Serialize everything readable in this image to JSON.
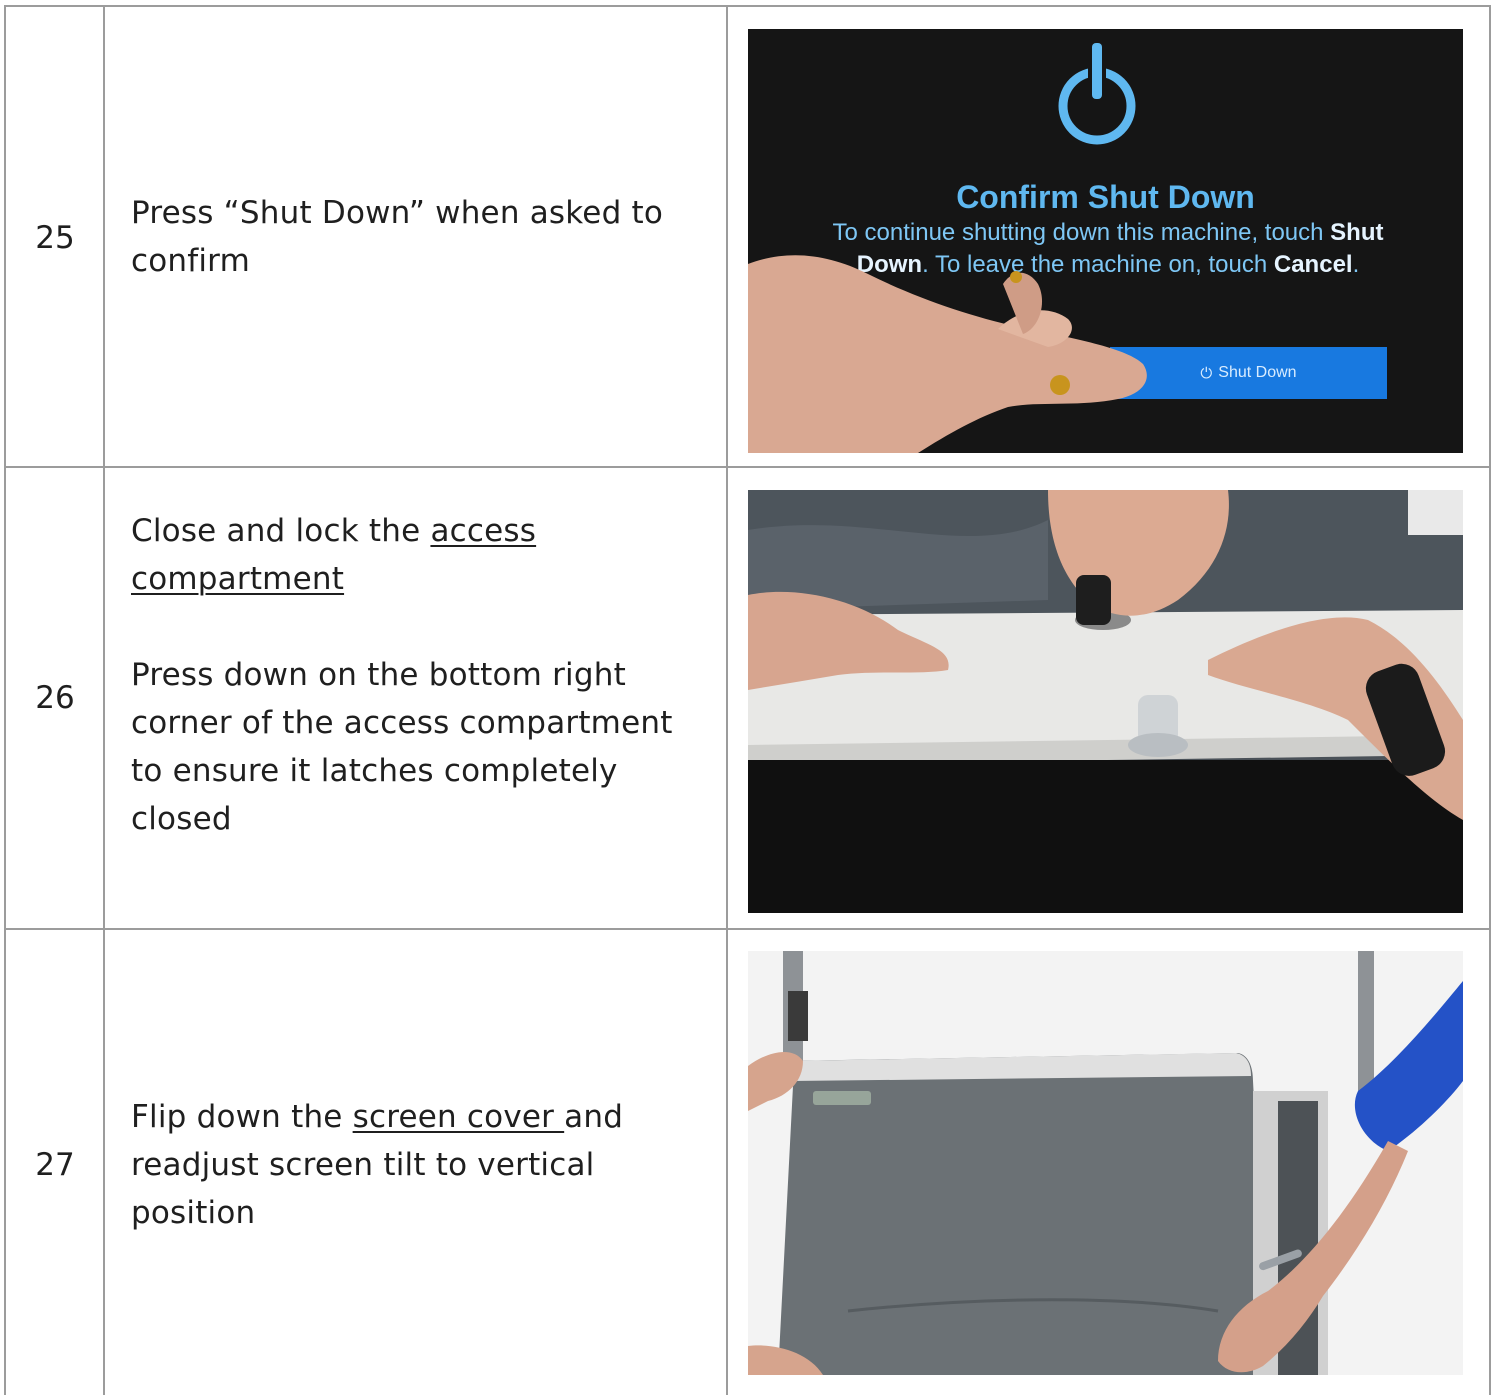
{
  "rows": [
    {
      "number": "25",
      "text": "Press “Shut Down” when asked to confirm",
      "photo": {
        "icon": "power-icon",
        "title": "Confirm Shut Down",
        "msg_part1": "To continue shutting down this machine, touch ",
        "msg_bold1": "Shut Down",
        "msg_part2": ". To leave the machine on, touch ",
        "msg_bold2": "Cancel",
        "msg_part3": ".",
        "button_label": "Shut Down"
      }
    },
    {
      "number": "26",
      "text_pre": "Close and lock the ",
      "text_link": "access compartment",
      "text2": "Press down on the bottom right corner of the access compartment to ensure it latches completely closed"
    },
    {
      "number": "27",
      "text_pre": "Flip down the ",
      "text_link": "screen cover ",
      "text_post": "and readjust screen tilt to vertical position"
    }
  ],
  "colors": {
    "grid": "#9c9c9c",
    "screen_text": "#5fb8f0",
    "button": "#1879e0"
  }
}
